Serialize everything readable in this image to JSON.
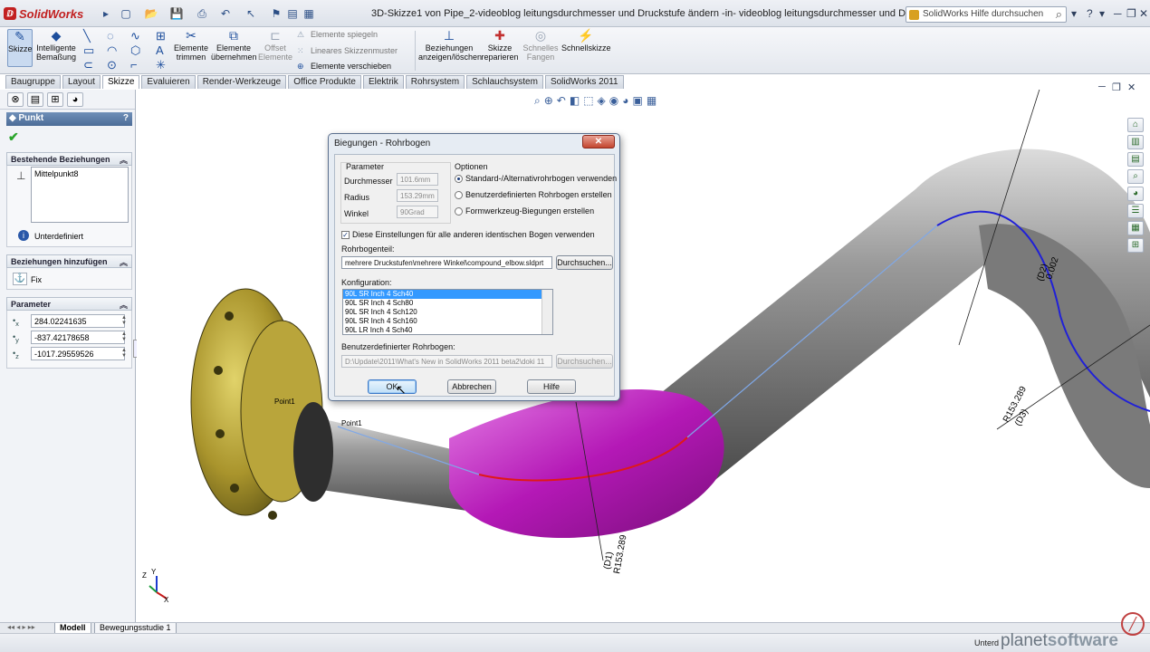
{
  "app": {
    "name": "SolidWorks",
    "window_title": "3D-Skizze1 von Pipe_2-videoblog leitungsdurchmesser und Druckstufe ändern -in- videoblog leitungsdurchmesser und Druckstufe ändern.SLDASM *",
    "help_search_placeholder": "SolidWorks Hilfe durchsuchen",
    "window_controls": [
      "?",
      "▾",
      "─",
      "❐",
      "✕"
    ]
  },
  "command_manager": {
    "tools": {
      "sketch": "Skizze",
      "smart_dim_line1": "Intelligente",
      "smart_dim_line2": "Bemaßung",
      "trim_line1": "Elemente",
      "trim_line2": "trimmen",
      "convert_line1": "Elemente",
      "convert_line2": "übernehmen",
      "offset_line1": "Offset",
      "offset_line2": "Elemente",
      "mirror": "Elemente spiegeln",
      "linear_pattern": "Lineares Skizzenmuster",
      "move": "Elemente verschieben",
      "relations_line1": "Beziehungen",
      "relations_line2": "anzeigen/löschen",
      "repair_line1": "Skizze",
      "repair_line2": "reparieren",
      "snap_line1": "Schnelles",
      "snap_line2": "Fangen",
      "quick_sketch": "Schnellskizze"
    },
    "tabs": [
      "Baugruppe",
      "Layout",
      "Skizze",
      "Evaluieren",
      "Render-Werkzeuge",
      "Office Produkte",
      "Elektrik",
      "Rohrsystem",
      "Schlauchsystem",
      "SolidWorks 2011"
    ]
  },
  "property_manager": {
    "title": "Punkt",
    "help": "?",
    "existing_relations": {
      "header": "Bestehende Beziehungen",
      "items": [
        "Mittelpunkt8"
      ],
      "status": "Unterdefiniert"
    },
    "add_relations": {
      "header": "Beziehungen hinzufügen",
      "items": [
        "Fix"
      ]
    },
    "parameters": {
      "header": "Parameter",
      "x_label": "x",
      "y_label": "y",
      "z_label": "z",
      "x": "284.02241635",
      "y": "-837.42178658",
      "z": "-1017.29559526"
    }
  },
  "dialog": {
    "title": "Biegungen - Rohrbogen",
    "close": "✕",
    "parameter_header": "Parameter",
    "diameter_label": "Durchmesser",
    "diameter_value": "101.6mm",
    "radius_label": "Radius",
    "radius_value": "153.29mm",
    "angle_label": "Winkel",
    "angle_value": "90Grad",
    "options_header": "Optionen",
    "option_standard": "Standard-/Alternativrohrbogen verwenden",
    "option_custom": "Benutzerdefinierten Rohrbogen erstellen",
    "option_formtool": "Formwerkzeug-Biegungen erstellen",
    "apply_all": "Diese Einstellungen für alle anderen identischen Bogen verwenden",
    "elbow_part_label": "Rohrbogenteil:",
    "elbow_part_value": "mehrere Druckstufen\\mehrere Winkel\\compound_elbow.sldprt",
    "browse": "Durchsuchen...",
    "config_label": "Konfiguration:",
    "configs": [
      "90L SR Inch 4 Sch40",
      "90L SR Inch 4 Sch80",
      "90L SR Inch 4 Sch120",
      "90L SR Inch 4 Sch160",
      "90L LR Inch 4 Sch40"
    ],
    "custom_elbow_label": "Benutzerdefinierter Rohrbogen:",
    "custom_elbow_value": "D:\\Update\\2011\\What's New in SolidWorks 2011 beta2\\doki 11",
    "browse2": "Durchsuchen...",
    "ok": "OK",
    "cancel": "Abbrechen",
    "help": "Hilfe"
  },
  "viewport": {
    "point1": "Point1",
    "point2": "Point1",
    "dim_top": "0.002",
    "dim_top2": "(D2)",
    "dim_right": "R153.289",
    "dim_right2": "(D3)",
    "dim_bottom": "R153.289",
    "dim_bottom2": "(D1)",
    "triad_z": "Z",
    "triad_x": "X",
    "triad_y": "Y"
  },
  "bottom": {
    "tabs": [
      "Modell",
      "Bewegungsstudie 1"
    ],
    "status": "Unterd"
  },
  "watermark": {
    "planet": "planet",
    "software": "software"
  },
  "colors": {
    "pipe_gray": "#8c8c8c",
    "elbow_magenta": "#c21fc4",
    "flange_gold": "#b29e2b",
    "sketch_blue": "#2020d8",
    "sketch_red": "#e01818"
  }
}
